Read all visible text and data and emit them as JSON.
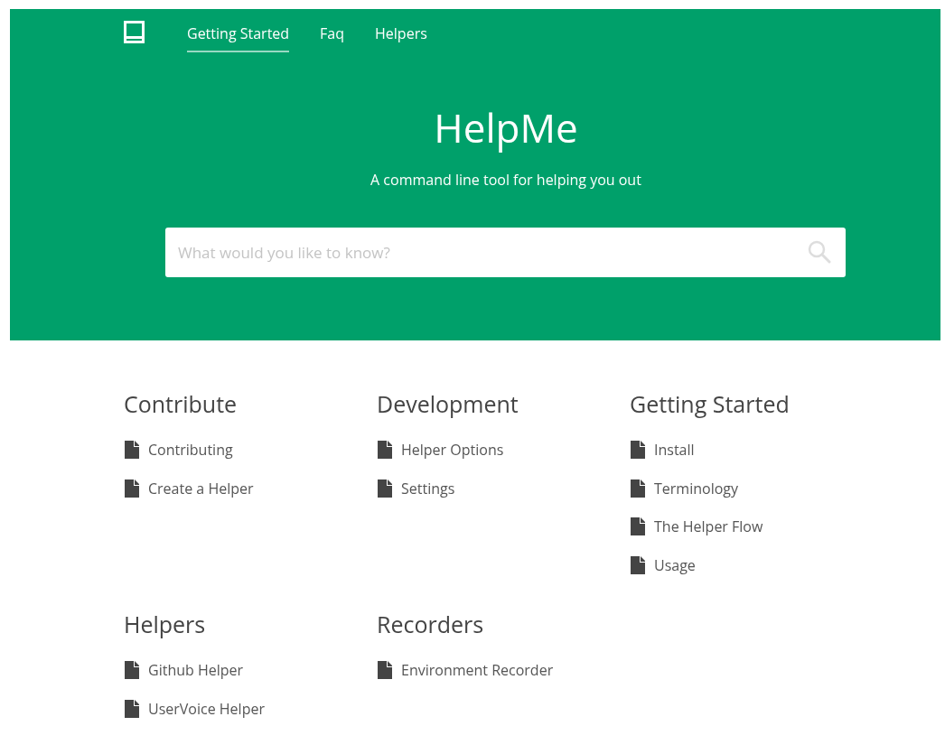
{
  "nav": {
    "items": [
      {
        "label": "Getting Started",
        "selected": true
      },
      {
        "label": "Faq",
        "selected": false
      },
      {
        "label": "Helpers",
        "selected": false
      }
    ]
  },
  "hero": {
    "title": "HelpMe",
    "subtitle": "A command line tool for helping you out"
  },
  "search": {
    "placeholder": "What would you like to know?"
  },
  "sections": [
    {
      "title": "Contribute",
      "items": [
        "Contributing",
        "Create a Helper"
      ]
    },
    {
      "title": "Development",
      "items": [
        "Helper Options",
        "Settings"
      ]
    },
    {
      "title": "Getting Started",
      "items": [
        "Install",
        "Terminology",
        "The Helper Flow",
        "Usage"
      ]
    },
    {
      "title": "Helpers",
      "items": [
        "Github Helper",
        "UserVoice Helper"
      ]
    },
    {
      "title": "Recorders",
      "items": [
        "Environment Recorder"
      ]
    }
  ]
}
